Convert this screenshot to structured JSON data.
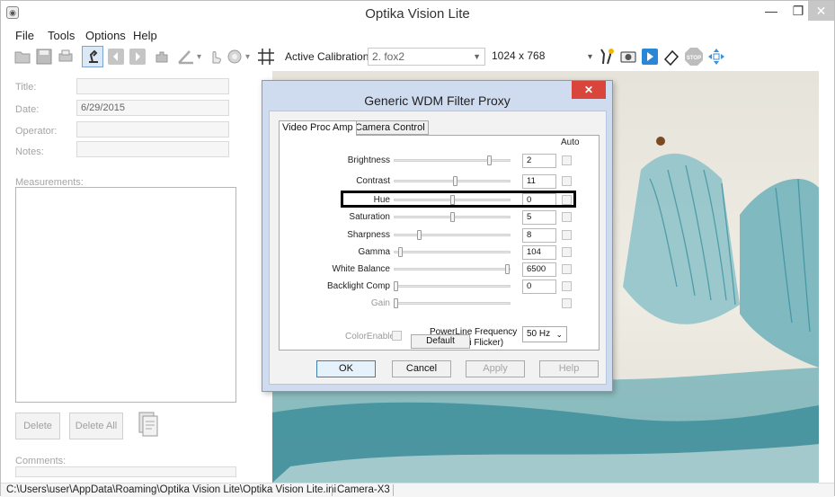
{
  "window": {
    "title": "Optika Vision Lite",
    "controls": {
      "minimize": "—",
      "maximize": "❐",
      "close": "✕"
    }
  },
  "menu": [
    "File",
    "Tools",
    "Options",
    "Help"
  ],
  "toolbar": {
    "calibration_label": "Active Calibration",
    "calibration_value": "2. fox2",
    "resolution_value": "1024 x 768"
  },
  "left_panel": {
    "title_label": "Title:",
    "date_label": "Date:",
    "date_value": "6/29/2015",
    "operator_label": "Operator:",
    "notes_label": "Notes:",
    "measurements_label": "Measurements:",
    "delete_label": "Delete",
    "delete_all_label": "Delete All",
    "comments_label": "Comments:"
  },
  "status_bar": {
    "path": "C:\\Users\\user\\AppData\\Roaming\\Optika Vision Lite\\Optika Vision Lite.ini",
    "camera": "Camera-X3"
  },
  "dialog": {
    "title": "Generic WDM Filter Proxy",
    "close": "✕",
    "tabs": [
      "Video Proc Amp",
      "Camera Control"
    ],
    "auto_header": "Auto",
    "controls": [
      {
        "name": "brightness",
        "label": "Brightness",
        "value": "2",
        "level": 0.83,
        "enabled": true
      },
      {
        "name": "contrast",
        "label": "Contrast",
        "value": "11",
        "level": 0.53,
        "enabled": true
      },
      {
        "name": "hue",
        "label": "Hue",
        "value": "0",
        "level": 0.5,
        "enabled": true
      },
      {
        "name": "saturation",
        "label": "Saturation",
        "value": "5",
        "level": 0.5,
        "enabled": true
      },
      {
        "name": "sharpness",
        "label": "Sharpness",
        "value": "8",
        "level": 0.21,
        "enabled": true
      },
      {
        "name": "gamma",
        "label": "Gamma",
        "value": "104",
        "level": 0.04,
        "enabled": true
      },
      {
        "name": "white-balance",
        "label": "White Balance",
        "value": "6500",
        "level": 0.99,
        "enabled": true
      },
      {
        "name": "backlight-comp",
        "label": "Backlight Comp",
        "value": "0",
        "level": 0.0,
        "enabled": true
      },
      {
        "name": "gain",
        "label": "Gain",
        "value": "",
        "level": 0.0,
        "enabled": false
      }
    ],
    "color_enable_label": "ColorEnable",
    "powerline_label": "PowerLine Frequency",
    "powerline_sub": "(Anti Flicker)",
    "powerline_value": "50 Hz",
    "default_label": "Default",
    "buttons": {
      "ok": "OK",
      "cancel": "Cancel",
      "apply": "Apply",
      "help": "Help"
    }
  }
}
